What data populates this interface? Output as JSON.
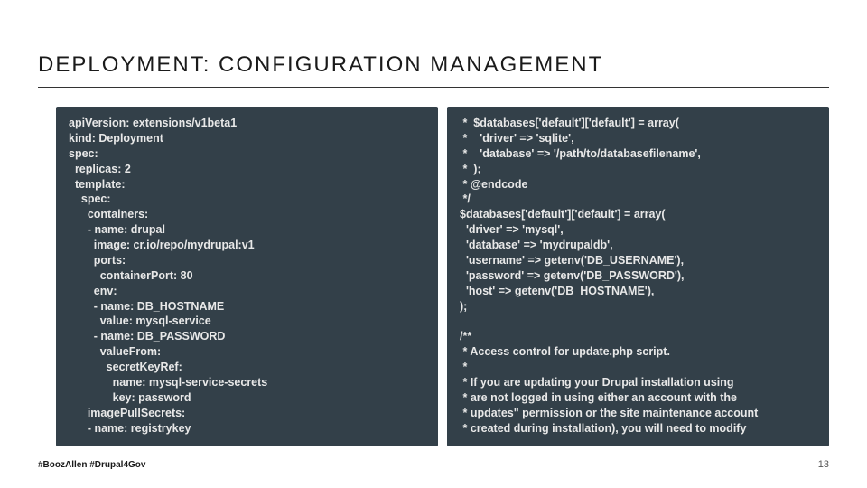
{
  "title": "DEPLOYMENT: CONFIGURATION MANAGEMENT",
  "code_left": "apiVersion: extensions/v1beta1\nkind: Deployment\nspec:\n  replicas: 2\n  template:\n    spec:\n      containers:\n      - name: drupal\n        image: cr.io/repo/mydrupal:v1\n        ports:\n          containerPort: 80\n        env:\n        - name: DB_HOSTNAME\n          value: mysql-service\n        - name: DB_PASSWORD\n          valueFrom:\n            secretKeyRef:\n              name: mysql-service-secrets\n              key: password\n      imagePullSecrets:\n      - name: registrykey",
  "code_right": " *  $databases['default']['default'] = array(\n *    'driver' => 'sqlite',\n *    'database' => '/path/to/databasefilename',\n *  );\n * @endcode\n */\n$databases['default']['default'] = array(\n  'driver' => 'mysql',\n  'database' => 'mydrupaldb',\n  'username' => getenv('DB_USERNAME'),\n  'password' => getenv('DB_PASSWORD'),\n  'host' => getenv('DB_HOSTNAME'),\n);\n\n/**\n * Access control for update.php script.\n *\n * If you are updating your Drupal installation using\n * are not logged in using either an account with the\n * updates\" permission or the site maintenance account\n * created during installation), you will need to modify",
  "footer_left": "#BoozAllen #Drupal4Gov",
  "page_number": "13"
}
